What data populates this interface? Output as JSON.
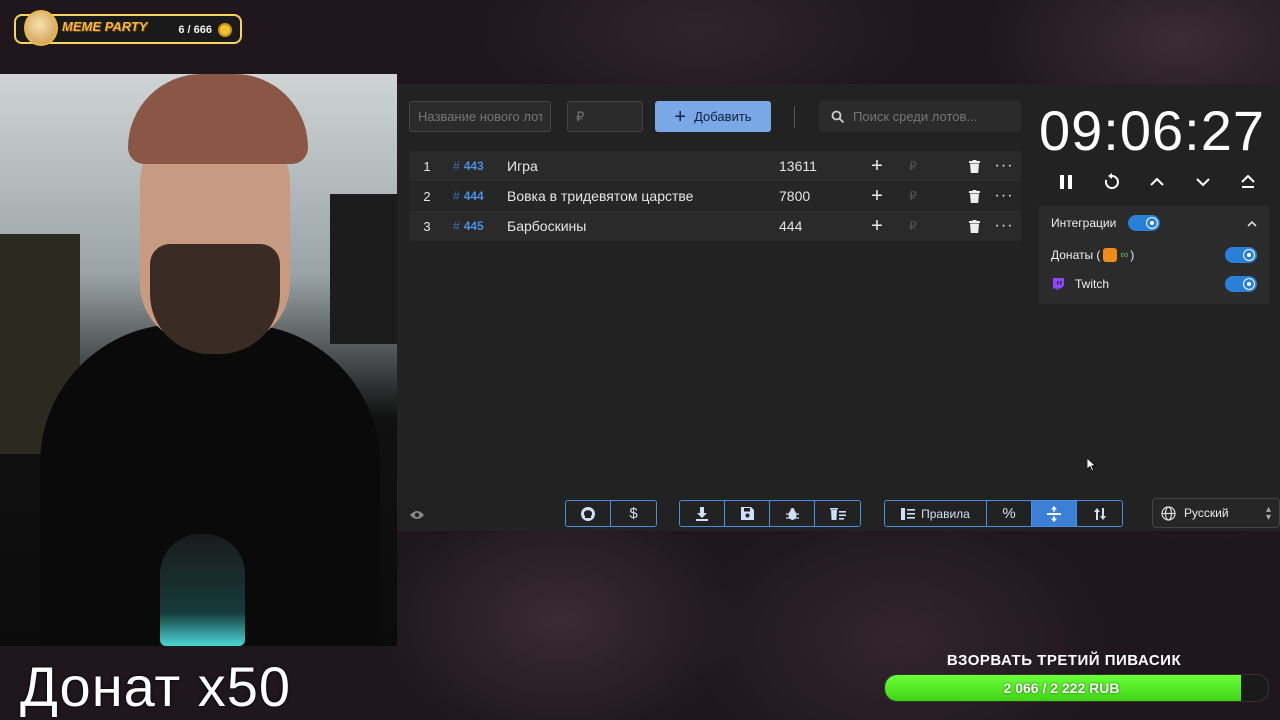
{
  "overlay": {
    "meme_title": "MEME PARTY",
    "meme_count": "6 / 666",
    "donat_label": "Донат x50",
    "goal_title": "ВЗОРВАТЬ ТРЕТИЙ ПИВАСИК",
    "goal_text": "2 066 / 2 222 RUB",
    "goal_progress": 0.93
  },
  "toolbar": {
    "lot_placeholder": "Название нового лота",
    "price_placeholder": "₽",
    "add_label": "Добавить",
    "search_placeholder": "Поиск среди лотов..."
  },
  "lots": [
    {
      "index": "1",
      "id": "443",
      "name": "Игра",
      "amount": "13611"
    },
    {
      "index": "2",
      "id": "444",
      "name": "Вовка в тридевятом царстве",
      "amount": "7800"
    },
    {
      "index": "3",
      "id": "445",
      "name": "Барбоскины",
      "amount": "444"
    }
  ],
  "timer": {
    "value": "09:06:27"
  },
  "integrations": {
    "title": "Интеграции",
    "donations_label": "Донаты (",
    "donations_suffix": ")",
    "twitch_label": "Twitch"
  },
  "bottom": {
    "rules_label": "Правила",
    "percent_label": "%",
    "language": "Русский"
  },
  "colors": {
    "accent": "#4a90e2",
    "add_button": "#7aa7e6",
    "goal_fill": "#4fe01d",
    "twitch": "#9146ff"
  }
}
